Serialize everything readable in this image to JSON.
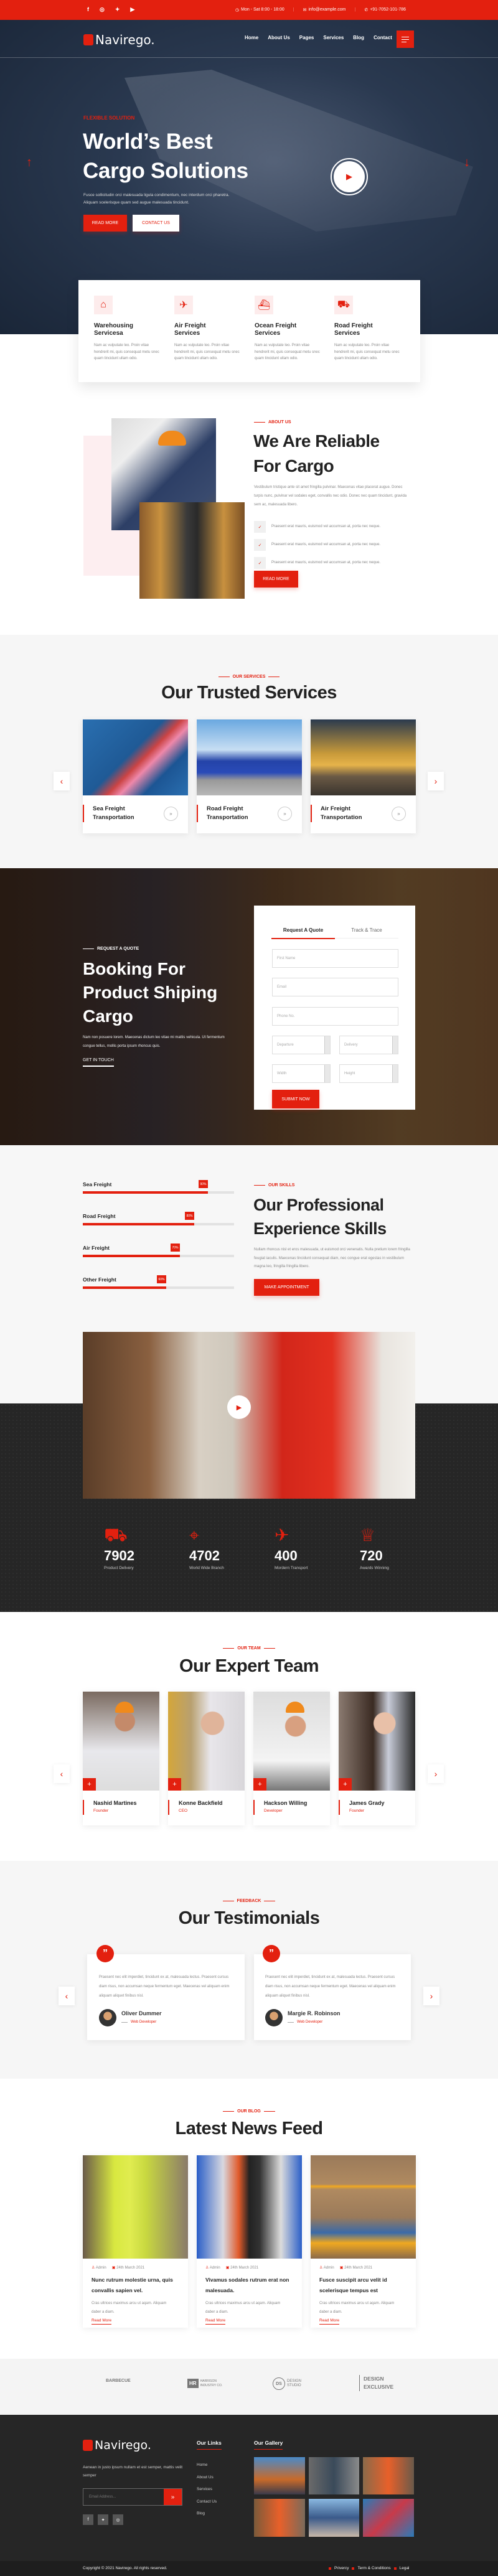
{
  "colors": {
    "accent": "#e3200f",
    "dark": "#222222",
    "navy": "#1b2a3f"
  },
  "topbar": {
    "social_icons": [
      "facebook-icon",
      "instagram-icon",
      "twitter-icon",
      "youtube-icon"
    ],
    "hours": "Mon - Sat 8:00 - 18:00",
    "email": "info@example.com",
    "phone": "+91-7052-101-786"
  },
  "nav": {
    "logo": "Navirego.",
    "items": [
      "Home",
      "About Us",
      "Pages",
      "Services",
      "Blog",
      "Contact"
    ]
  },
  "hero": {
    "tag": "FLEXIBLE SOLUTION",
    "title_1": "World’s Best",
    "title_2": "Cargo Solutions",
    "text_1": "Fusce sollicitudin orci malesuada ligula condimentum, nec interdum orci pharetra.",
    "text_2": "Aliquam scelerisque quam sed augue malesuada tincidunt.",
    "read_more": "READ MORE",
    "contact": "CONTACT US"
  },
  "features": [
    {
      "title_1": "Warehousing",
      "title_2": "Servicesa",
      "icon": "warehouse-icon",
      "text": "Nam ac vulputate leo. Proin vitae hendrerit mi, quis consequat metu snec quam tincidunt ullam odio."
    },
    {
      "title_1": "Air Freight",
      "title_2": "Services",
      "icon": "air-freight-icon",
      "text": "Nam ac vulputate leo. Proin vitae hendrerit mi, quis consequat metu snec quam tincidunt ullam odio."
    },
    {
      "title_1": "Ocean Freight",
      "title_2": "Services",
      "icon": "ship-icon",
      "text": "Nam ac vulputate leo. Proin vitae hendrerit mi, quis consequat metu snec quam tincidunt ullam odio."
    },
    {
      "title_1": "Road Freight",
      "title_2": "Services",
      "icon": "truck-icon",
      "text": "Nam ac vulputate leo. Proin vitae hendrerit mi, quis consequat metu snec quam tincidunt ullam odio."
    }
  ],
  "about": {
    "tag": "ABOUT US",
    "title_1": "We Are Reliable",
    "title_2": "For Cargo",
    "text": "Vestibulum tristique ante sit amet fringilla pulvinar. Maecenas vitae placerat augue. Donec turpis nunc, pulvinar vel sodales eget, convallis nec odio. Donec nec quam tincidunt, gravida sem ac, malesuada libero.",
    "checks": [
      "Praesent erat mauris, euismod vel accumsan at, porta nec neque.",
      "Praesent erat mauris, euismod vel accumsan at, porta nec neque.",
      "Praesent erat mauris, euismod vel accumsan at, porta nec neque."
    ],
    "button": "READ MORE"
  },
  "services": {
    "tag": "OUR SERVICES",
    "title": "Our Trusted Services",
    "cards": [
      {
        "l1": "Sea Freight",
        "l2": "Transportation"
      },
      {
        "l1": "Road Freight",
        "l2": "Transportation"
      },
      {
        "l1": "Air Freight",
        "l2": "Transportation"
      }
    ]
  },
  "booking": {
    "tag": "REQUEST A QUOTE",
    "title_1": "Booking For",
    "title_2": "Product Shiping",
    "title_3": "Cargo",
    "text": "Nam non posuere lorem. Maecenas dictum leo vitae mi mattis vehicula. Ut fermentum congue tellus, mollis porta ipsum rhoncus quis.",
    "link": "GET IN TOUCH",
    "tabs": [
      "Request A Quote",
      "Track & Trace"
    ],
    "active_tab": "Request A Quote",
    "placeholders": {
      "first_name": "First Name",
      "email": "Email",
      "phone": "Phone No.",
      "departure": "Departure",
      "delivery": "Delivery",
      "width": "Width",
      "height": "Height"
    },
    "submit": "SUBMIT NOW"
  },
  "skills": {
    "tag": "OUR SKILLS",
    "title_1": "Our Professional",
    "title_2": "Experience Skills",
    "text": "Nullam rhoncus nisl et eros malesuada, ut euismod orci venenatis. Nulla pretium lorem fringilla feugiat iaculis. Maecenas tincidunt consequat diam, nec congue erat egestas in vestibulum magna leo, fringilla fringilla libero.",
    "button": "MAKE APPOINTMENT",
    "bars": [
      {
        "label": "Sea Freight",
        "value": 90,
        "text": "90%"
      },
      {
        "label": "Road Freight",
        "value": 80,
        "text": "80%"
      },
      {
        "label": "Air Freight",
        "value": 70,
        "text": "70%"
      },
      {
        "label": "Other Freight",
        "value": 60,
        "text": "60%"
      }
    ]
  },
  "stats": [
    {
      "value": "7902",
      "label": "Product Delivery",
      "icon": "truck-icon"
    },
    {
      "value": "4702",
      "label": "World Wide Branch",
      "icon": "map-pin-icon"
    },
    {
      "value": "400",
      "label": "Mordern Transport",
      "icon": "airplane-icon"
    },
    {
      "value": "720",
      "label": "Awards Winning",
      "icon": "trophy-icon"
    }
  ],
  "team": {
    "tag": "OUR TEAM",
    "title": "Our Expert Team",
    "members": [
      {
        "name": "Nashid Martines",
        "role": "Founder"
      },
      {
        "name": "Konne Backfield",
        "role": "CEO"
      },
      {
        "name": "Hackson Willing",
        "role": "Developer"
      },
      {
        "name": "James Grady",
        "role": "Founder"
      }
    ]
  },
  "testimonials": {
    "tag": "FEEDBACK",
    "title": "Our Testimonials",
    "items": [
      {
        "text": "Praesent nec elit imperdiet, tincidunt ex at, malesuada lectus. Praesent cursus diam risus, non accumsan neque fermentum eget. Maecenas vel aliquam enim aliquam aliquet finibus nisl.",
        "name": "Oliver Dummer",
        "role": "Web Developer"
      },
      {
        "text": "Praesent nec elit imperdiet, tincidunt ex at, malesuada lectus. Praesent cursus diam risus, non accumsan neque fermentum eget. Maecenas vel aliquam enim aliquam aliquet finibus nisl.",
        "name": "Margie R. Robinson",
        "role": "Web Developer"
      }
    ]
  },
  "blog": {
    "tag": "OUR BLOG",
    "title": "Latest News Feed",
    "posts": [
      {
        "author": "Admin",
        "date": "24th March 2021",
        "title": "Nunc rutrum molestie urna, quis convallis sapien vel.",
        "text": "Cras ultrices maximus arcu ut aqam. Aliquam daber a diam.",
        "link": "Read More"
      },
      {
        "author": "Admin",
        "date": "24th March 2021",
        "title": "Vivamus sodales rutrum erat non malesuada.",
        "text": "Cras ultrices maximus arcu ut aqam. Aliquam daber a diam.",
        "link": "Read More"
      },
      {
        "author": "Admin",
        "date": "24th March 2021",
        "title": "Fusce suscipit arcu velit id scelerisque tempus est",
        "text": "Cras ultrices maximus arcu ut aqam. Aliquam daber a diam.",
        "link": "Read More"
      }
    ]
  },
  "brands": [
    "BARBECUE",
    "HARRISON INDUSTRY CO.",
    "DESIGN STUDIO",
    "DESIGN EXCLUSIVE"
  ],
  "footer": {
    "logo": "Navirego.",
    "text": "Aenean in justo ipsum nullam et est semper, mattis velit semper",
    "email_placeholder": "Email Address...",
    "links_title": "Our Links",
    "links": [
      "Home",
      "About Us",
      "Services",
      "Contact Us",
      "Blog"
    ],
    "gallery_title": "Our Gallery",
    "copyright": "Copyright © 2021 Navirego. All rights reserved.",
    "bottom_links": [
      "Privercy",
      "Term & Conditions",
      "Legal"
    ]
  }
}
